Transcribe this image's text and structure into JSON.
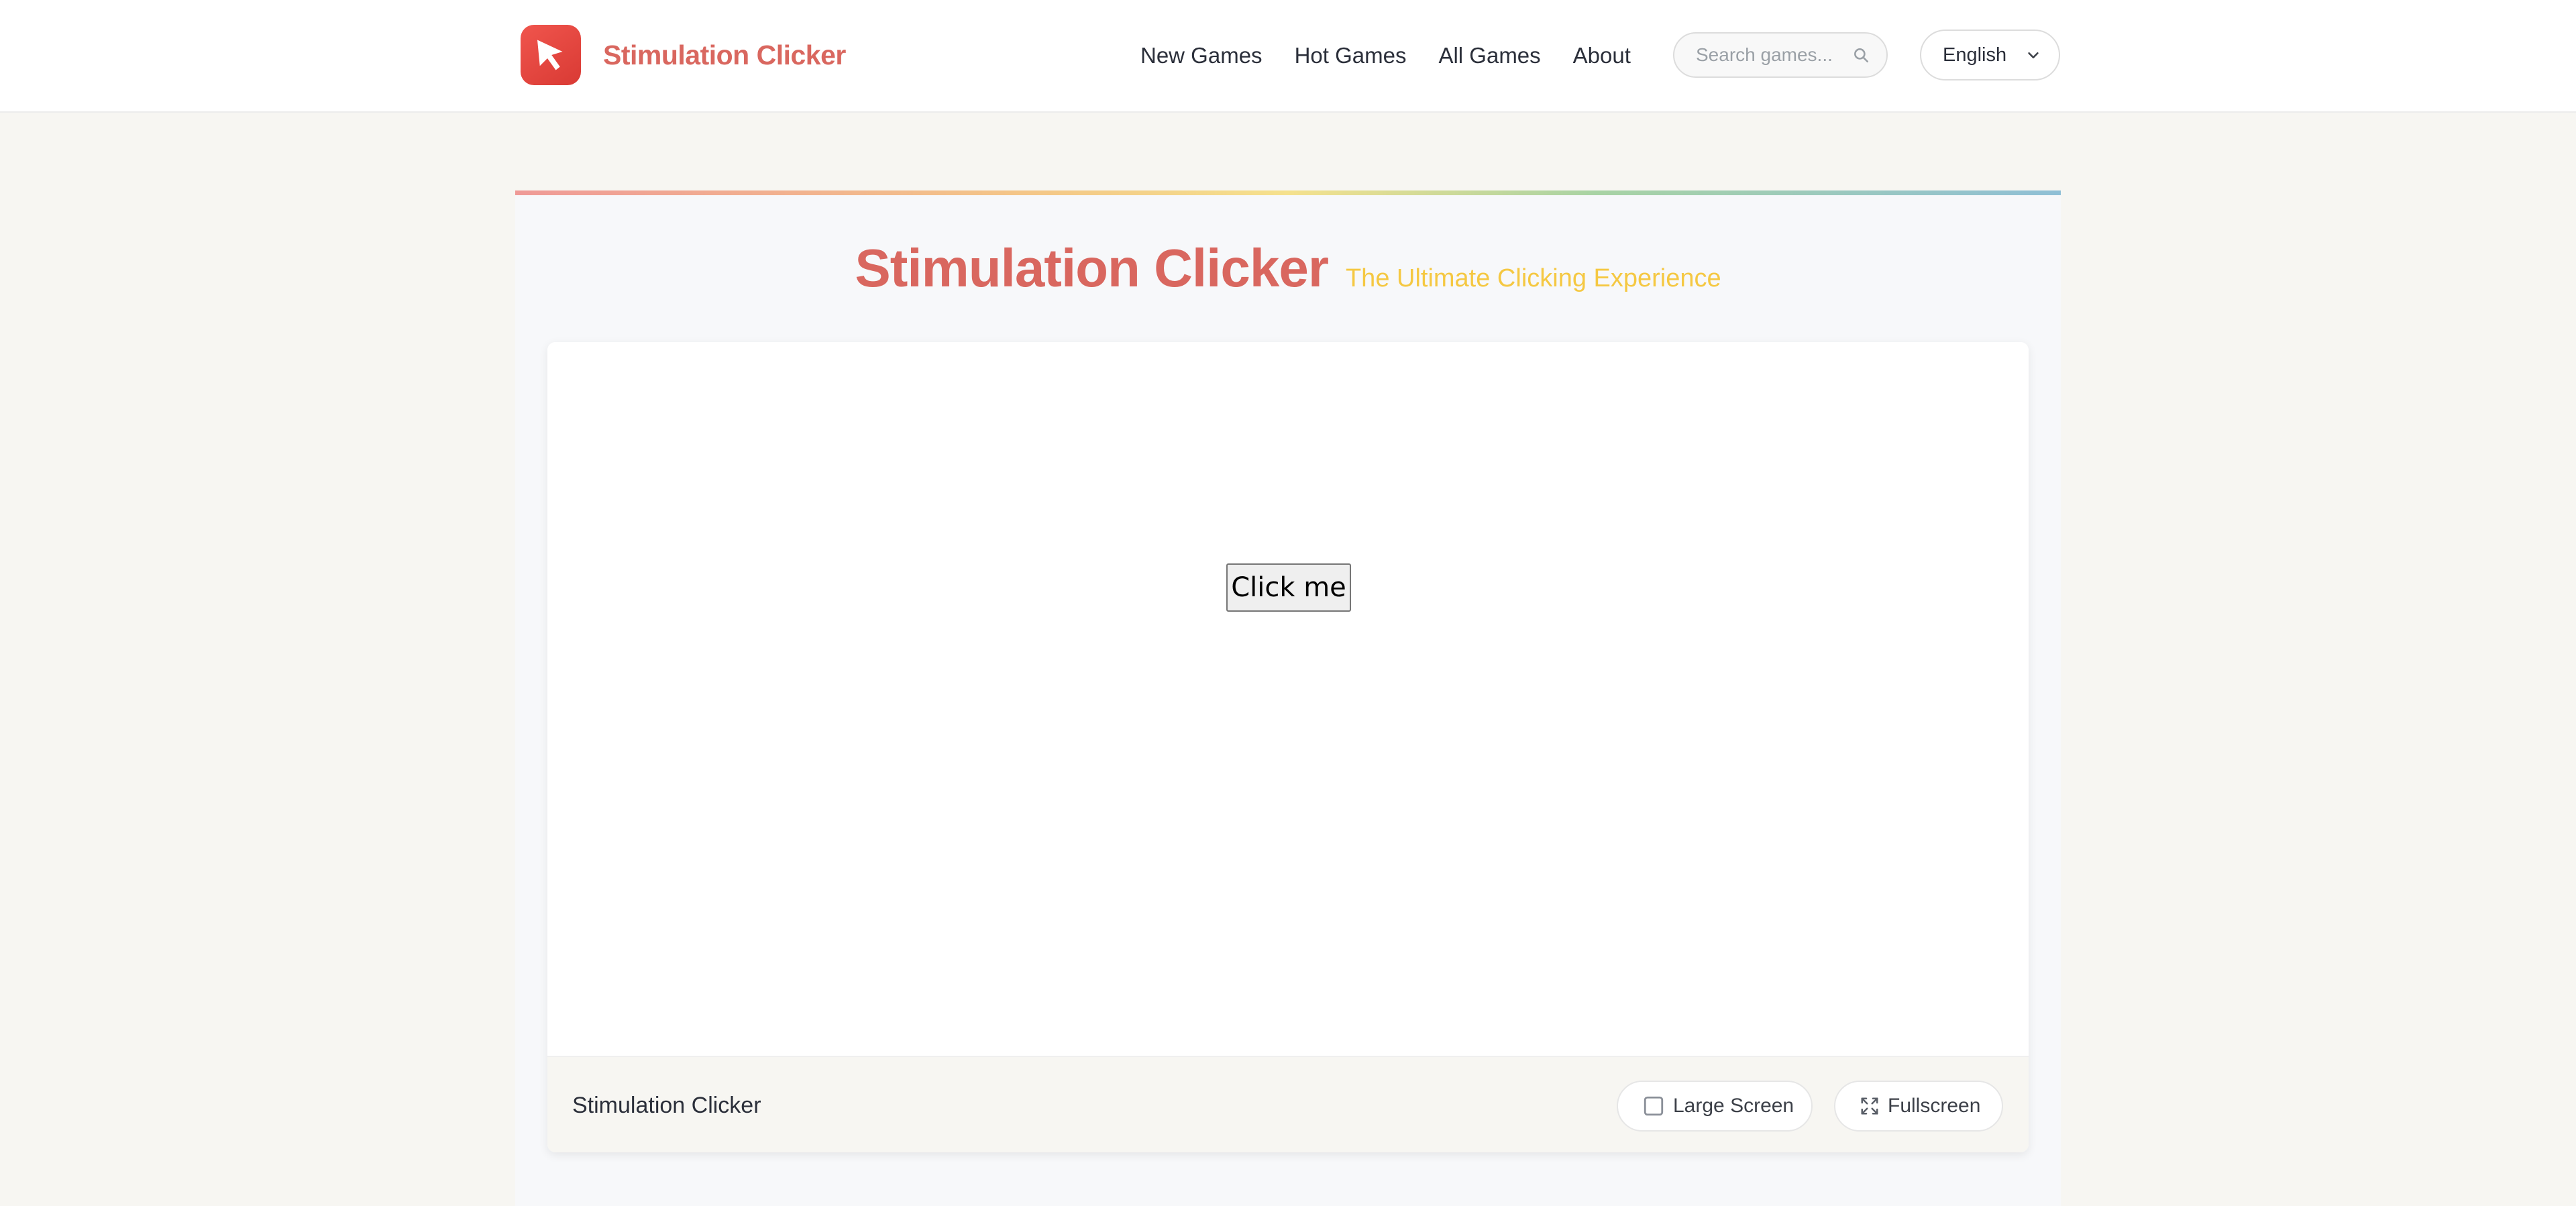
{
  "header": {
    "brand_name": "Stimulation Clicker",
    "nav": [
      {
        "label": "New Games"
      },
      {
        "label": "Hot Games"
      },
      {
        "label": "All Games"
      },
      {
        "label": "About"
      }
    ],
    "search": {
      "placeholder": "Search games...",
      "value": ""
    },
    "language": {
      "selected": "English"
    }
  },
  "main": {
    "title": "Stimulation Clicker",
    "subtitle": "The Ultimate Clicking Experience",
    "game": {
      "button_label": "Click me"
    },
    "toolbar": {
      "title": "Stimulation Clicker",
      "large_screen_label": "Large Screen",
      "fullscreen_label": "Fullscreen"
    }
  },
  "colors": {
    "brand": "#d9675f",
    "logo": "#e8453e",
    "subtitle": "#f5c842",
    "page_bg": "#f7f6f2"
  },
  "icons": {
    "logo": "cursor-arrow-icon",
    "search": "search-icon",
    "language": "chevron-down-icon",
    "large_screen": "square-icon",
    "fullscreen": "expand-icon"
  }
}
